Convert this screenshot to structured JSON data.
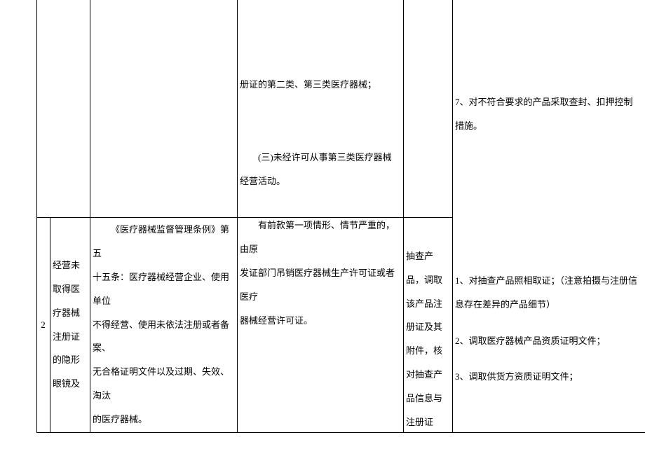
{
  "row1": {
    "col4_part1": "册证的第二类、第三类医疗器械；",
    "col4_part2": "(三)未经许可从事第三类医疗器械经营活动。",
    "col4_part3_line1": "有前款第一项情形、情节严重的，由原",
    "col4_part3_line2": "发证部门吊销医疗器械生产许可证或者医疗",
    "col4_part3_line3": "器械经营许可证。",
    "col6_item7": "7、对不符合要求的产品采取查封、扣押控制措施。"
  },
  "row2": {
    "col1": "2",
    "col2": "经营未取得医疗器械注册证的隐形眼镜及",
    "col3_line1": "《医疗器械监督管理条例》第五",
    "col3_line2": "十五条：医疗器械经营企业、使用单位",
    "col3_line3": "不得经营、使用未依法注册或者备案、",
    "col3_line4": "无合格证明文件以及过期、失效、淘汰",
    "col3_line5": "的医疗器械。",
    "col5": "抽查产品，调取该产品注册证及其附件，核对抽查产品信息与注册证",
    "col6_item1": "1、对抽查产品照相取证；（注意拍摄与注册信息存在差异的产品细节）",
    "col6_item2": "2、调取医疗器械产品资质证明文件；",
    "col6_item3": "3、调取供货方资质证明文件；"
  }
}
